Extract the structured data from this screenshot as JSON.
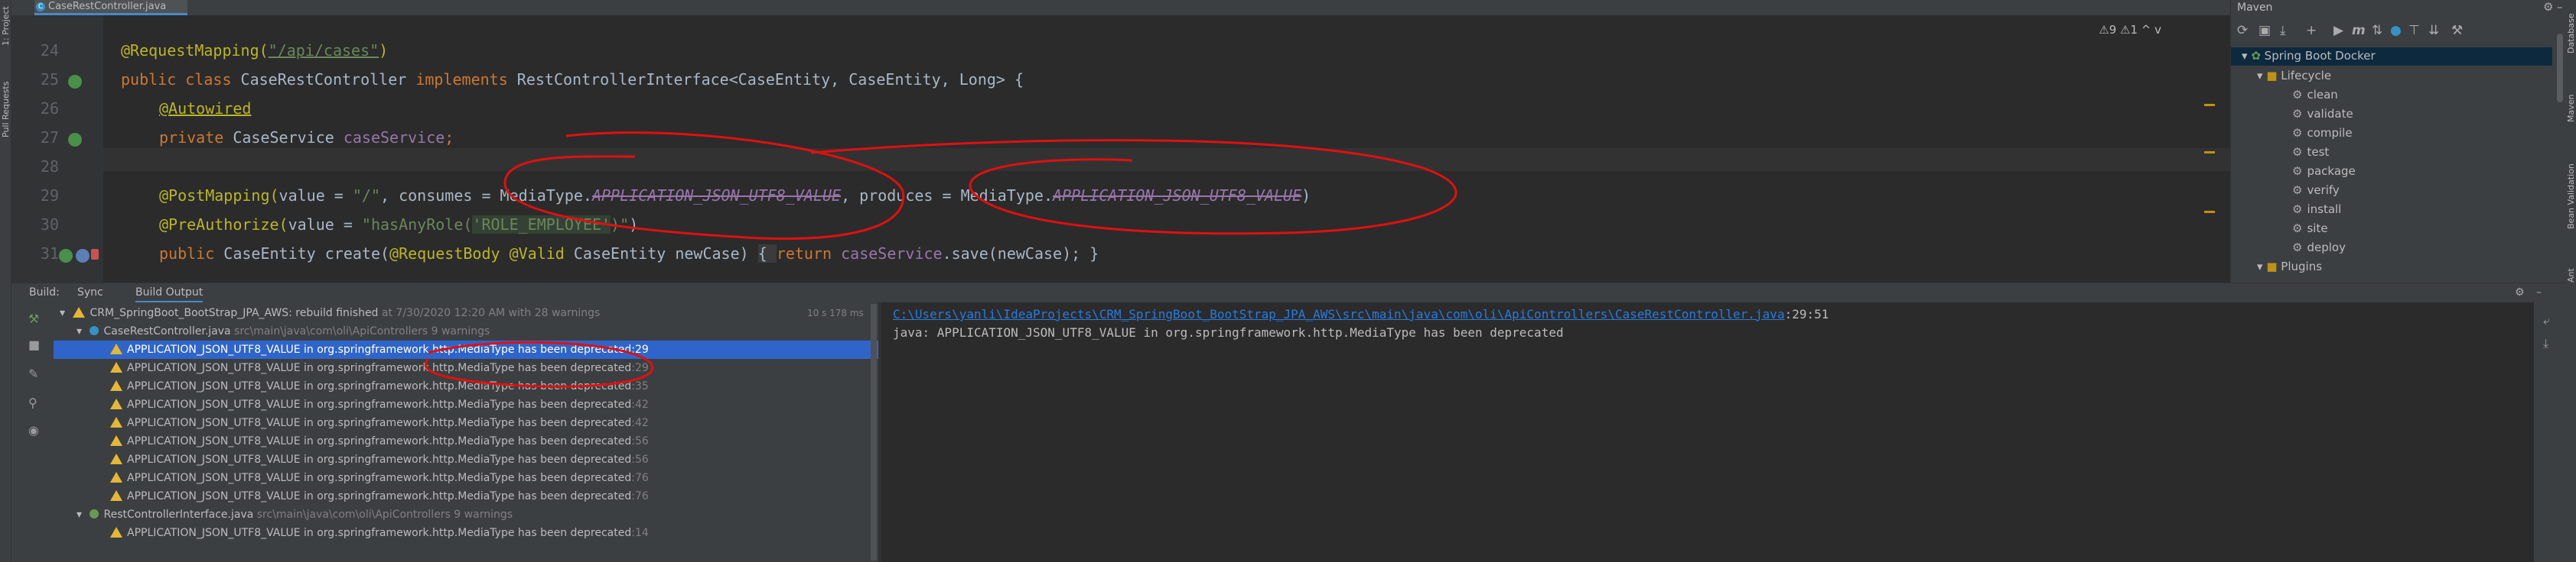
{
  "editor": {
    "tab_label": "CaseRestController.java",
    "warnings_badge": "⚠9 ⚠1 ^ v",
    "lines": [
      {
        "num": "24"
      },
      {
        "num": "25"
      },
      {
        "num": "26"
      },
      {
        "num": "27"
      },
      {
        "num": "28"
      },
      {
        "num": "29"
      },
      {
        "num": "30"
      },
      {
        "num": "31"
      }
    ],
    "code": {
      "l24_ann": "@RequestMapping(",
      "l24_str": "\"/api/cases\"",
      "l24_end": ")",
      "l25_kw1": "public class ",
      "l25_name": "CaseRestController ",
      "l25_kw2": "implements ",
      "l25_rest": "RestControllerInterface<CaseEntity, CaseEntity, Long> {",
      "l26_ann": "@Autowired",
      "l27_kw": "private ",
      "l27_type": "CaseService ",
      "l27_fld": "caseService",
      "l27_end": ";",
      "l29_ann": "@PostMapping(",
      "l29_a": "value = ",
      "l29_s1": "\"/\"",
      "l29_b": ", consumes = MediaType.",
      "l29_dep1": "APPLICATION_JSON_UTF8_VALUE",
      "l29_c": ", produces = MediaType.",
      "l29_dep2": "APPLICATION_JSON_UTF8_VALUE",
      "l29_d": ")",
      "l30_ann": "@PreAuthorize(",
      "l30_a": "value = ",
      "l30_s1": "\"hasAnyRole(",
      "l30_s2": "'ROLE_EMPLOYEE'",
      "l30_s3": ")\"",
      "l30_d": ")",
      "l31_kw": "public ",
      "l31_a": "CaseEntity create(",
      "l31_ann1": "@RequestBody ",
      "l31_ann2": "@Valid ",
      "l31_b": "CaseEntity newCase) ",
      "l31_c": "{ ",
      "l31_kw2": "return ",
      "l31_fld": "caseService",
      "l31_d": ".save(newCase); }"
    }
  },
  "left_strip": {
    "project": "1: Project",
    "pull_requests": "Pull Requests"
  },
  "right_strip": {
    "database": "Database",
    "maven": "Maven",
    "bean_validation": "Bean Validation",
    "ant": "Ant"
  },
  "maven": {
    "title": "Maven",
    "project": "Spring Boot Docker",
    "lifecycle": "Lifecycle",
    "goals": [
      "clean",
      "validate",
      "compile",
      "test",
      "package",
      "verify",
      "install",
      "site",
      "deploy"
    ],
    "plugins": "Plugins"
  },
  "build": {
    "label": "Build:",
    "tabs": [
      "Sync",
      "Build Output"
    ],
    "root": "CRM_SpringBoot_BootStrap_JPA_AWS:",
    "root_status": " rebuild finished",
    "root_detail": " at 7/30/2020 12:20 AM with 28 warnings",
    "root_time": "10 s 178 ms",
    "file1": "CaseRestController.java",
    "file1_path": " src\\main\\java\\com\\oli\\ApiControllers 9 warnings",
    "warnings": [
      {
        "text": "APPLICATION_JSON_UTF8_VALUE in org.springframework.http.MediaType has been deprecated",
        "line": ":29"
      },
      {
        "text": "APPLICATION_JSON_UTF8_VALUE in org.springframework.http.MediaType has been deprecated",
        "line": ":29"
      },
      {
        "text": "APPLICATION_JSON_UTF8_VALUE in org.springframework.http.MediaType has been deprecated",
        "line": ":35"
      },
      {
        "text": "APPLICATION_JSON_UTF8_VALUE in org.springframework.http.MediaType has been deprecated",
        "line": ":42"
      },
      {
        "text": "APPLICATION_JSON_UTF8_VALUE in org.springframework.http.MediaType has been deprecated",
        "line": ":42"
      },
      {
        "text": "APPLICATION_JSON_UTF8_VALUE in org.springframework.http.MediaType has been deprecated",
        "line": ":56"
      },
      {
        "text": "APPLICATION_JSON_UTF8_VALUE in org.springframework.http.MediaType has been deprecated",
        "line": ":56"
      },
      {
        "text": "APPLICATION_JSON_UTF8_VALUE in org.springframework.http.MediaType has been deprecated",
        "line": ":76"
      },
      {
        "text": "APPLICATION_JSON_UTF8_VALUE in org.springframework.http.MediaType has been deprecated",
        "line": ":76"
      }
    ],
    "file2": "RestControllerInterface.java",
    "file2_path": " src\\main\\java\\com\\oli\\ApiControllers 9 warnings",
    "file2_warning": {
      "text": "APPLICATION_JSON_UTF8_VALUE in org.springframework.http.MediaType has been deprecated",
      "line": ":14"
    },
    "console_link": "C:\\Users\\yanli\\IdeaProjects\\CRM_SpringBoot_BootStrap_JPA_AWS\\src\\main\\java\\com\\oli\\ApiControllers\\CaseRestController.java",
    "console_pos": ":29:51",
    "console_msg": "java: APPLICATION_JSON_UTF8_VALUE in org.springframework.http.MediaType has been deprecated"
  },
  "colors": {
    "accent": "#2f65ca",
    "warning": "#e5b735",
    "annotation": "#bbb529",
    "keyword": "#cc7832",
    "ink": "#e01010"
  }
}
